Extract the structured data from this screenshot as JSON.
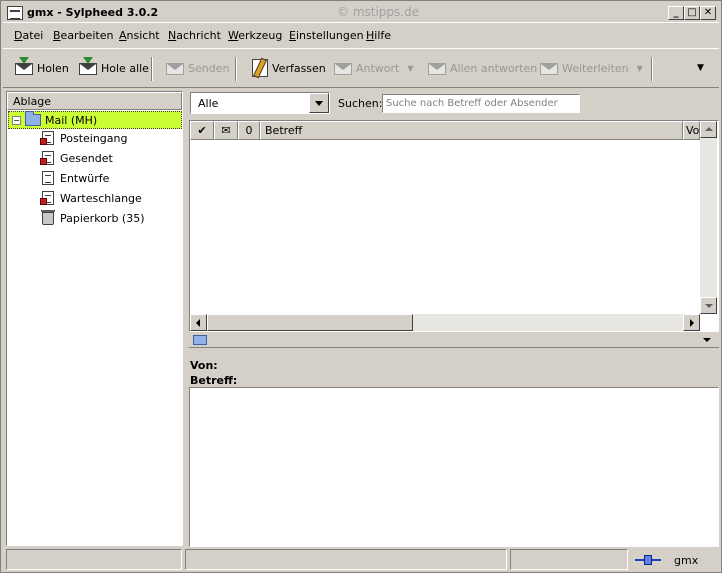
{
  "window": {
    "title": "gmx - Sylpheed 3.0.2",
    "watermark": "© mstipps.de",
    "buttons": {
      "minimize": "_",
      "maximize": "□",
      "close": "✕"
    }
  },
  "menubar": [
    {
      "label_ul": "D",
      "label_rest": "atei"
    },
    {
      "label_ul": "B",
      "label_rest": "earbeiten"
    },
    {
      "label_ul": "A",
      "label_rest": "nsicht"
    },
    {
      "label_ul": "N",
      "label_rest": "achricht"
    },
    {
      "label_ul": "W",
      "label_rest": "erkzeug"
    },
    {
      "label_ul": "E",
      "label_rest": "instellungen"
    },
    {
      "label_ul": "H",
      "label_rest": "ilfe"
    }
  ],
  "toolbar": {
    "holen": "Holen",
    "hole_alle": "Hole alle",
    "senden": "Senden",
    "verfassen": "Verfassen",
    "antwort": "Antwort",
    "allen_antworten": "Allen antworten",
    "weiterleiten": "Weiterleiten",
    "more": "▼"
  },
  "folder_pane": {
    "header": "Ablage",
    "root": {
      "expander": "−",
      "label": "Mail (MH)"
    },
    "folders": [
      {
        "label": "Posteingang"
      },
      {
        "label": "Gesendet"
      },
      {
        "label": "Entwürfe"
      },
      {
        "label": "Warteschlange"
      },
      {
        "label": "Papierkorb (35)"
      }
    ]
  },
  "filter": {
    "selected": "Alle",
    "search_label": "Suchen:",
    "search_placeholder": "Suche nach Betreff oder Absender",
    "search_value": ""
  },
  "message_list": {
    "columns": {
      "mark": "✔",
      "unread": "✉",
      "attach": "0",
      "subject": "Betreff",
      "from": "Von"
    }
  },
  "message_view": {
    "from_label": "Von:",
    "subject_label": "Betreff:"
  },
  "statusbar": {
    "account": "gmx"
  }
}
